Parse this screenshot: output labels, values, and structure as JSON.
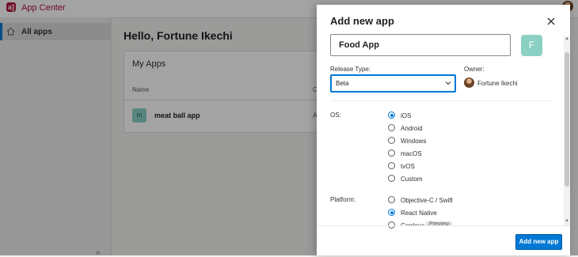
{
  "app": {
    "title": "App Center",
    "logo_text": "a]"
  },
  "sidebar": {
    "items": [
      {
        "label": "All apps"
      }
    ],
    "collapse_glyph": "«"
  },
  "main": {
    "greeting": "Hello, Fortune Ikechi",
    "card": {
      "title": "My Apps",
      "columns": [
        "Name",
        "O"
      ],
      "rows": [
        {
          "icon_letter": "m",
          "name": "meat ball app",
          "second": "A"
        }
      ]
    }
  },
  "panel": {
    "title": "Add new app",
    "app_name_value": "Food App",
    "avatar_letter": "F",
    "release_type": {
      "label": "Release Type:",
      "value": "Beta"
    },
    "owner": {
      "label": "Owner:",
      "name": "Fortune Ikechi"
    },
    "os": {
      "label": "OS:",
      "options": [
        "iOS",
        "Android",
        "Windows",
        "macOS",
        "tvOS",
        "Custom"
      ],
      "selected": "iOS"
    },
    "platform": {
      "label": "Platform:",
      "options": [
        "Objective-C / Swift",
        "React Native",
        "Cordova"
      ],
      "selected": "React Native",
      "preview_badge": "Preview"
    },
    "submit_label": "Add new app"
  },
  "colors": {
    "accent": "#0078d4",
    "brand": "#b4123d",
    "app_icon": "#8ad1c4"
  },
  "icons": [
    "home-icon",
    "close-icon",
    "chevron-down-icon",
    "collapse-icon"
  ]
}
